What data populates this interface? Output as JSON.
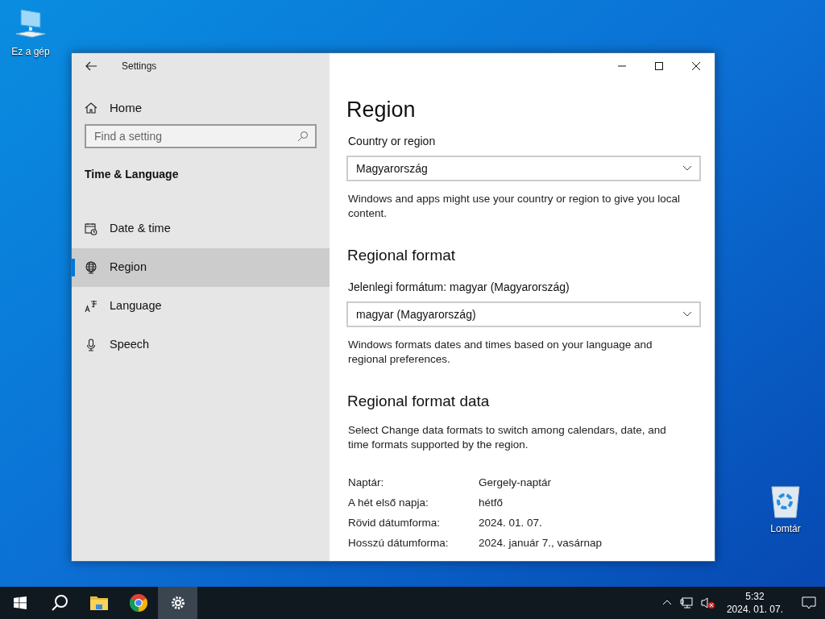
{
  "desktop_icons": [
    {
      "kind": "computer",
      "label": "Ez a gép"
    },
    {
      "kind": "recycle",
      "label": "Lomtár"
    }
  ],
  "window": {
    "title": "Settings"
  },
  "sidebar": {
    "home": "Home",
    "search": {
      "placeholder": "Find a setting"
    },
    "section": "Time & Language",
    "items": [
      {
        "kind": "calendar",
        "label": "Date & time",
        "selected": false
      },
      {
        "kind": "globe",
        "label": "Region",
        "selected": true
      },
      {
        "kind": "language",
        "label": "Language",
        "selected": false
      },
      {
        "kind": "mic",
        "label": "Speech",
        "selected": false
      }
    ]
  },
  "content": {
    "title": "Region",
    "country": {
      "label": "Country or region",
      "value": "Magyarország",
      "note": "Windows and apps might use your country or region to give you local content."
    },
    "regional_format": {
      "heading": "Regional format",
      "label": "Jelenlegi formátum: magyar (Magyarország)",
      "value": "magyar (Magyarország)",
      "note": "Windows formats dates and times based on your language and regional preferences."
    },
    "format_data": {
      "heading": "Regional format data",
      "note": "Select Change data formats to switch among calendars, date, and time formats supported by the region.",
      "rows": [
        {
          "label": "Naptár:",
          "value": "Gergely-naptár"
        },
        {
          "label": "A hét első napja:",
          "value": "hétfő"
        },
        {
          "label": "Rövid dátumforma:",
          "value": "2024. 01. 07."
        },
        {
          "label": "Hosszú dátumforma:",
          "value": "2024. január 7., vasárnap"
        }
      ]
    }
  },
  "taskbar": {
    "items": [
      {
        "kind": "start",
        "selected": false
      },
      {
        "kind": "search",
        "selected": false
      },
      {
        "kind": "folder",
        "selected": false
      },
      {
        "kind": "browser",
        "selected": false
      },
      {
        "kind": "settings",
        "selected": true
      }
    ],
    "time": "5:32",
    "date": "2024. 01. 07."
  }
}
